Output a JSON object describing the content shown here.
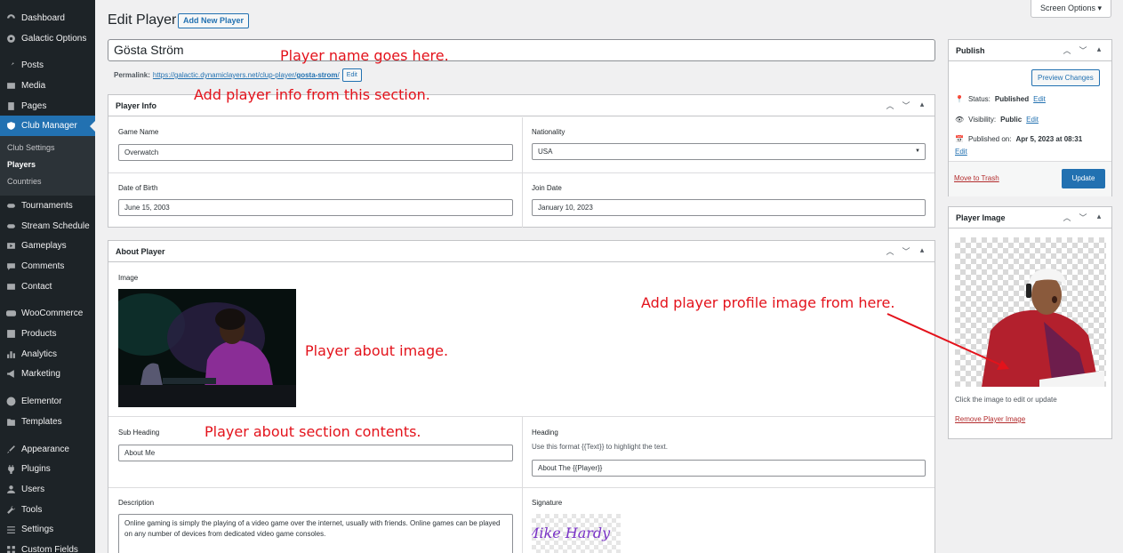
{
  "sidebar": {
    "items": [
      {
        "label": "Dashboard",
        "icon": "dashboard-icon"
      },
      {
        "label": "Galactic Options",
        "icon": "gear-icon"
      },
      {
        "label": "Posts",
        "icon": "pin-icon"
      },
      {
        "label": "Media",
        "icon": "media-icon"
      },
      {
        "label": "Pages",
        "icon": "page-icon"
      },
      {
        "label": "Club Manager",
        "icon": "shield-icon"
      },
      {
        "label": "Tournaments",
        "icon": "gamepad-icon"
      },
      {
        "label": "Stream Schedule",
        "icon": "gamepad-icon"
      },
      {
        "label": "Gameplays",
        "icon": "video-icon"
      },
      {
        "label": "Comments",
        "icon": "comment-icon"
      },
      {
        "label": "Contact",
        "icon": "mail-icon"
      },
      {
        "label": "WooCommerce",
        "icon": "woo-icon"
      },
      {
        "label": "Products",
        "icon": "box-icon"
      },
      {
        "label": "Analytics",
        "icon": "chart-icon"
      },
      {
        "label": "Marketing",
        "icon": "megaphone-icon"
      },
      {
        "label": "Elementor",
        "icon": "elementor-icon"
      },
      {
        "label": "Templates",
        "icon": "folder-icon"
      },
      {
        "label": "Appearance",
        "icon": "brush-icon"
      },
      {
        "label": "Plugins",
        "icon": "plug-icon"
      },
      {
        "label": "Users",
        "icon": "user-icon"
      },
      {
        "label": "Tools",
        "icon": "wrench-icon"
      },
      {
        "label": "Settings",
        "icon": "sliders-icon"
      },
      {
        "label": "Custom Fields",
        "icon": "grid-icon"
      }
    ],
    "submenu": [
      "Club Settings",
      "Players",
      "Countries"
    ]
  },
  "header": {
    "title": "Edit Player",
    "add_new": "Add New Player",
    "screen_options": "Screen Options ▾"
  },
  "title_field": {
    "value": "Gösta Ström"
  },
  "permalink": {
    "label": "Permalink:",
    "url_base": "https://galactic.dynamiclayers.net/clup-player/",
    "slug": "gosta-strom",
    "url_end": "/",
    "edit": "Edit"
  },
  "player_info": {
    "title": "Player Info",
    "game_name_label": "Game Name",
    "game_name_value": "Overwatch",
    "nationality_label": "Nationality",
    "nationality_value": "USA",
    "dob_label": "Date of Birth",
    "dob_value": "June 15, 2003",
    "join_label": "Join Date",
    "join_value": "January 10, 2023"
  },
  "about": {
    "title": "About Player",
    "image_label": "Image",
    "subheading_label": "Sub Heading",
    "subheading_value": "About Me",
    "heading_label": "Heading",
    "heading_hint": "Use this format {{Text}} to highlight the text.",
    "heading_value": "About The {{Player}}",
    "description_label": "Description",
    "description_value": "Online gaming is simply the playing of a video game over the internet, usually with friends. Online games can be played on any number of devices from dedicated video game consoles.",
    "signature_label": "Signature",
    "signature_text": "Mike Hardy"
  },
  "publish": {
    "title": "Publish",
    "preview": "Preview Changes",
    "status_label": "Status:",
    "status_value": "Published",
    "visibility_label": "Visibility:",
    "visibility_value": "Public",
    "published_label": "Published on:",
    "published_value": "Apr 5, 2023 at 08:31",
    "edit": "Edit",
    "trash": "Move to Trash",
    "update": "Update"
  },
  "player_image": {
    "title": "Player Image",
    "hint": "Click the image to edit or update",
    "remove": "Remove Player Image"
  },
  "annotations": {
    "name": "Player name goes here.",
    "info": "Add player info from this section.",
    "about_image": "Player about image.",
    "about_contents": "Player about section contents.",
    "profile_image": "Add player profile image from here."
  },
  "colors": {
    "accent": "#2271b1",
    "annotation": "#e3121b",
    "sidebar": "#1d2327"
  }
}
